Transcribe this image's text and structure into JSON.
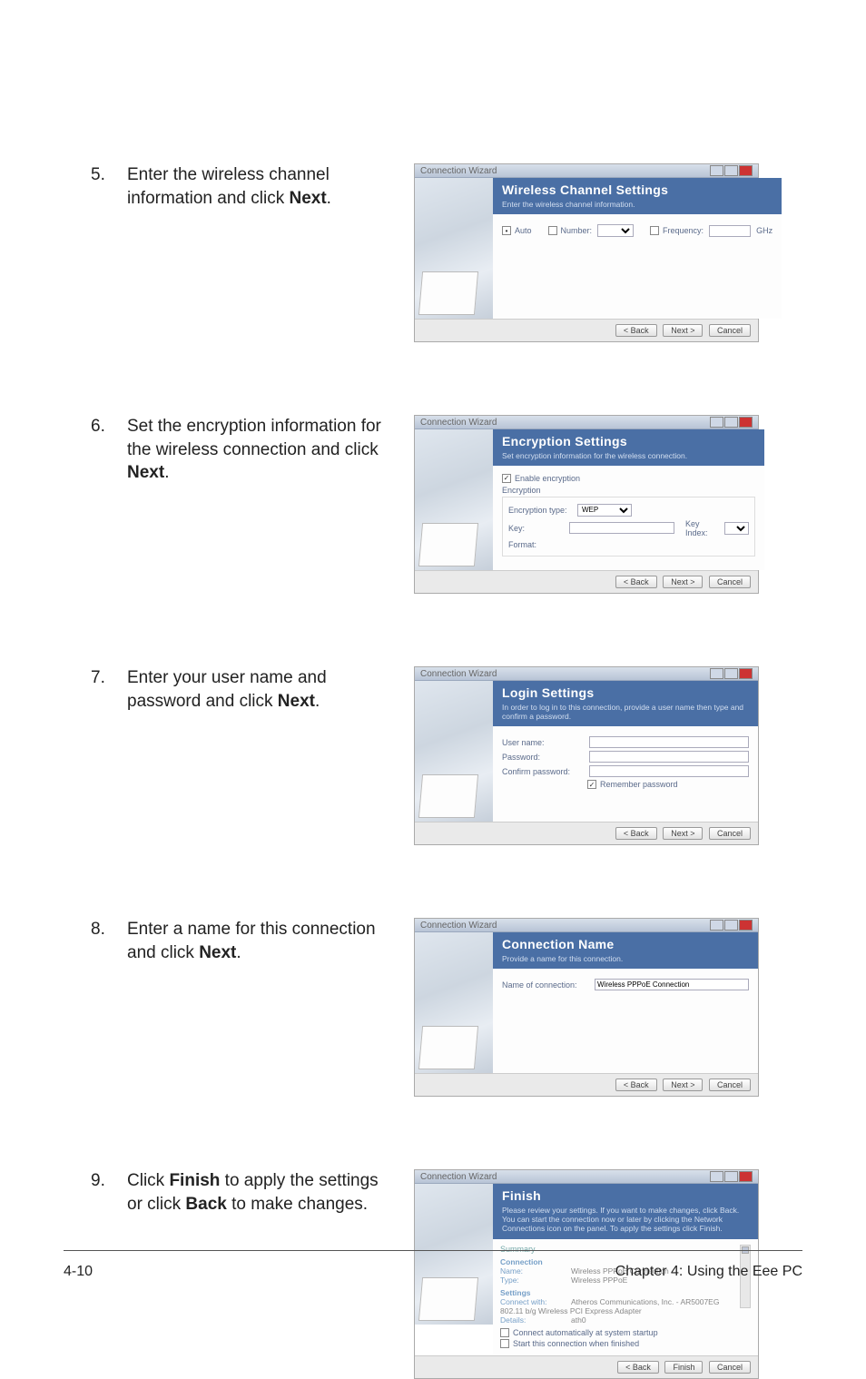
{
  "steps": [
    {
      "num": "5.",
      "text_a": "Enter the wireless channel information and click ",
      "bold": "Next",
      "text_b": "."
    },
    {
      "num": "6.",
      "text_a": "Set the encryption information for the wireless connection and click ",
      "bold": "Next",
      "text_b": "."
    },
    {
      "num": "7.",
      "text_a": "Enter your user name and password and click ",
      "bold": "Next",
      "text_b": "."
    },
    {
      "num": "8.",
      "text_a": "Enter a name for this connection and click ",
      "bold": "Next",
      "text_b": "."
    },
    {
      "num": "9.",
      "text_a": "Click ",
      "bold": "Finish",
      "text_b": " to apply the settings or click ",
      "bold2": "Back",
      "text_c": " to make changes."
    }
  ],
  "wizard_common": {
    "window_title": "Connection Wizard",
    "btn_back": "< Back",
    "btn_next": "Next >",
    "btn_cancel": "Cancel",
    "btn_finish": "Finish"
  },
  "w5": {
    "header": "Wireless Channel Settings",
    "sub": "Enter the wireless channel information.",
    "auto": "Auto",
    "number": "Number:",
    "frequency": "Frequency:",
    "ghz": "GHz"
  },
  "w6": {
    "header": "Encryption Settings",
    "sub": "Set encryption information for the wireless connection.",
    "enable": "Enable encryption",
    "grp": "Encryption",
    "type": "Encryption type:",
    "type_val": "WEP",
    "key": "Key:",
    "keyindex": "Key Index:",
    "format": "Format:"
  },
  "w7": {
    "header": "Login Settings",
    "sub": "In order to log in to this connection, provide a user name then type and confirm a password.",
    "user": "User name:",
    "pass": "Password:",
    "conf": "Confirm password:",
    "remember": "Remember password"
  },
  "w8": {
    "header": "Connection Name",
    "sub": "Provide a name for this connection.",
    "name": "Name of connection:",
    "name_val": "Wireless PPPoE Connection"
  },
  "w9": {
    "header": "Finish",
    "sub": "Please review your settings. If you want to make changes, click Back. You can start the connection now or later by clicking the Network Connections icon on the panel. To apply the settings click Finish.",
    "summary": "Summary",
    "connection": "Connection",
    "name_k": "Name:",
    "name_v": "Wireless PPPoE Connection",
    "type_k": "Type:",
    "type_v": "Wireless PPPoE",
    "settings": "Settings",
    "connect_k": "Connect with:",
    "connect_v": "Atheros Communications, Inc. - AR5007EG 802.11 b/g Wireless PCI Express Adapter",
    "details_k": "Details:",
    "details_v": "ath0",
    "auto": "Connect automatically at system startup",
    "start": "Start this connection when finished"
  },
  "footer": {
    "left": "4-10",
    "right": "Chapter 4: Using the Eee PC"
  }
}
